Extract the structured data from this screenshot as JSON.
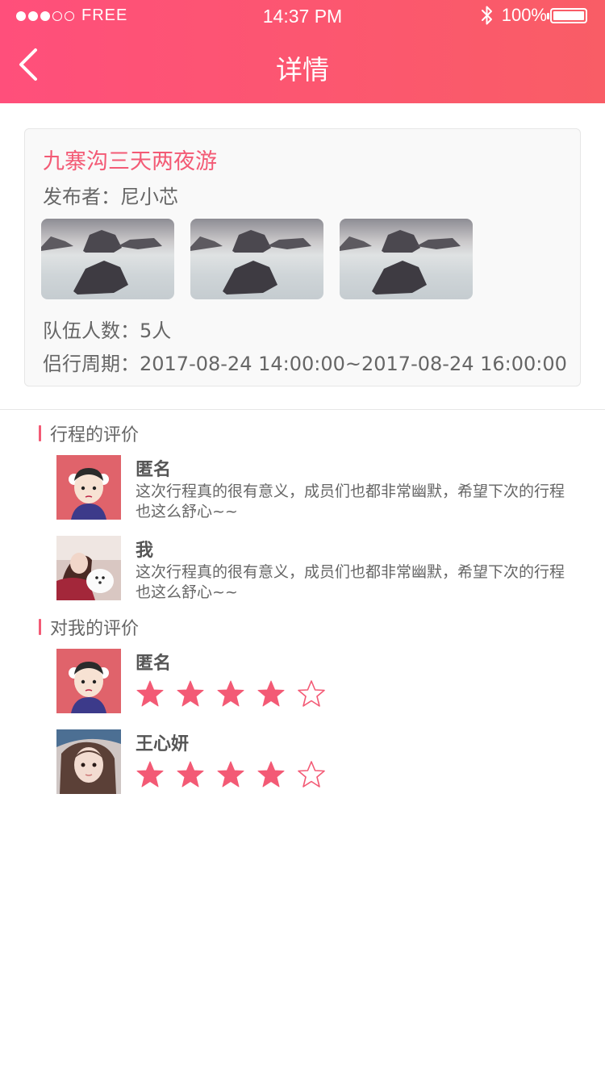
{
  "status_bar": {
    "carrier": "FREE",
    "time": "14:37 PM",
    "battery": "100%"
  },
  "nav": {
    "title": "详情"
  },
  "trip": {
    "title": "九寨沟三天两夜游",
    "publisher_label": "发布者：尼小芯",
    "photo_count": 3,
    "team_size_label": "队伍人数：5人",
    "period_label": "侣行周期：2017-08-24 14:00:00~2017-08-24 16:00:00"
  },
  "trip_reviews": {
    "title": "行程的评价",
    "items": [
      {
        "name": "匿名",
        "text": "这次行程真的很有意义，成员们也都非常幽默，希望下次的行程也这么舒心~~"
      },
      {
        "name": "我",
        "text": "这次行程真的很有意义，成员们也都非常幽默，希望下次的行程也这么舒心~~"
      }
    ]
  },
  "my_reviews": {
    "title": "对我的评价",
    "items": [
      {
        "name": "匿名",
        "rating": 4,
        "max_rating": 5
      },
      {
        "name": "王心妍",
        "rating": 4,
        "max_rating": 5
      }
    ]
  },
  "colors": {
    "accent": "#f35a75",
    "header_start": "#ff4f7b",
    "header_end": "#f95d66"
  }
}
